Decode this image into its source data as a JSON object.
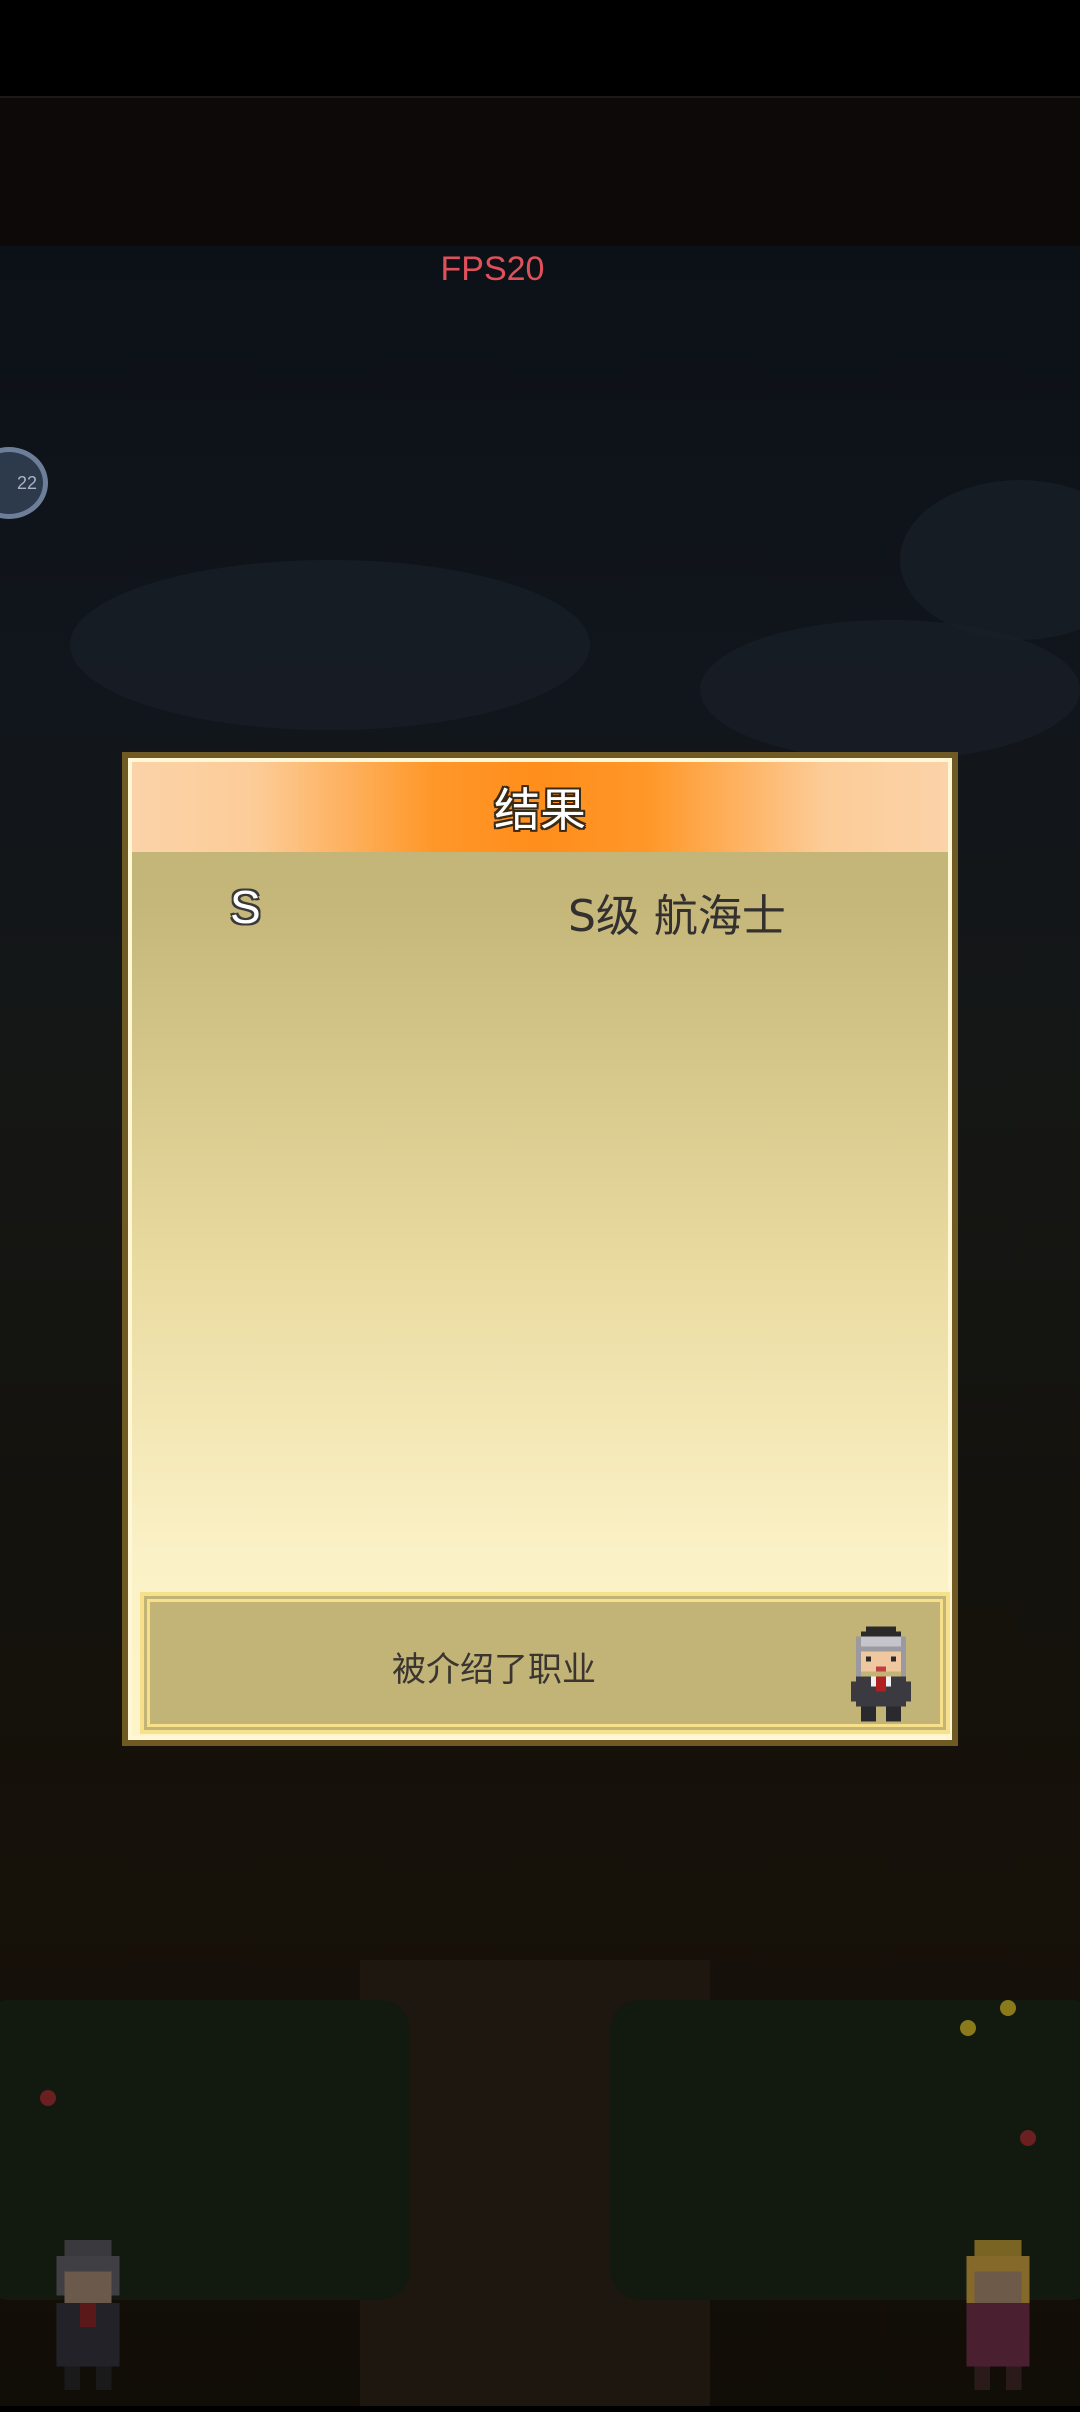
{
  "hud": {
    "fps_label": "FPS20",
    "side_badge": "22"
  },
  "modal": {
    "title": "结果",
    "result": {
      "grade": "S",
      "job": "S级 航海士"
    },
    "message": "被介绍了职业"
  },
  "icons": {
    "guide_avatar": "pixel-old-man-icon",
    "left_character": "pixel-girl-character",
    "right_character": "pixel-blonde-character"
  },
  "colors": {
    "header_accent": "#ff8e1c",
    "fps_text": "#e0505a",
    "panel_border": "#6e5a22"
  }
}
